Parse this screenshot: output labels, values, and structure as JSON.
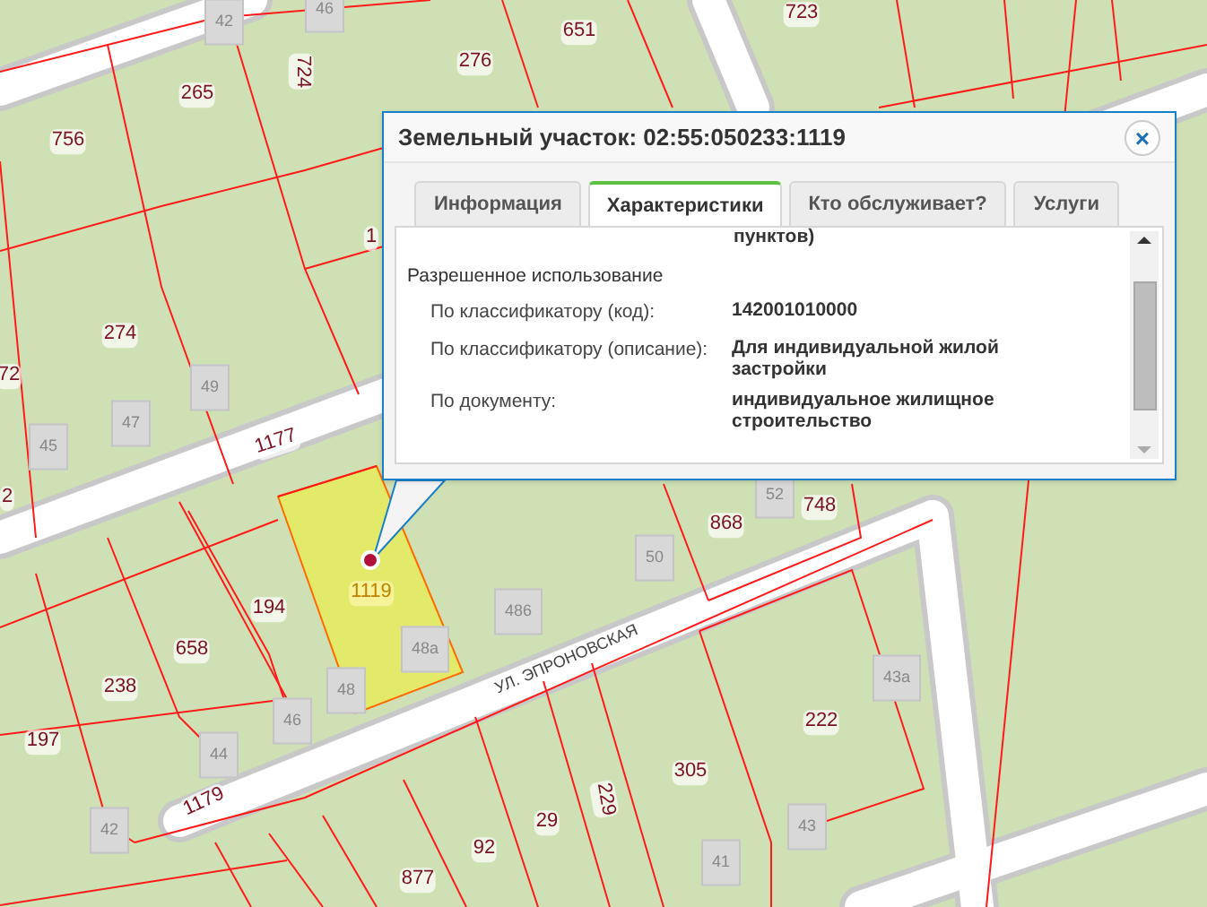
{
  "map": {
    "labels": [
      {
        "kind": "building",
        "text": "42"
      },
      {
        "kind": "building",
        "text": "46"
      },
      {
        "kind": "parcel",
        "text": "651"
      },
      {
        "kind": "parcel",
        "text": "723"
      },
      {
        "kind": "parcel",
        "text": "265"
      },
      {
        "kind": "parcel",
        "text": "724"
      },
      {
        "kind": "parcel",
        "text": "276"
      },
      {
        "kind": "parcel",
        "text": "756"
      },
      {
        "kind": "parcel",
        "text": "274"
      },
      {
        "kind": "parcel",
        "text": "72"
      },
      {
        "kind": "parcel",
        "text": "1"
      },
      {
        "kind": "parcel",
        "text": "1177"
      },
      {
        "kind": "building",
        "text": "49"
      },
      {
        "kind": "building",
        "text": "47"
      },
      {
        "kind": "building",
        "text": "45"
      },
      {
        "kind": "parcel",
        "text": "2"
      },
      {
        "kind": "parcel",
        "text": "868"
      },
      {
        "kind": "building",
        "text": "52"
      },
      {
        "kind": "parcel",
        "text": "748"
      },
      {
        "kind": "building",
        "text": "50"
      },
      {
        "kind": "building",
        "text": "486"
      },
      {
        "kind": "selected",
        "text": "1119"
      },
      {
        "kind": "building",
        "text": "48а"
      },
      {
        "kind": "parcel",
        "text": "194"
      },
      {
        "kind": "parcel",
        "text": "658"
      },
      {
        "kind": "parcel",
        "text": "238"
      },
      {
        "kind": "parcel",
        "text": "197"
      },
      {
        "kind": "building",
        "text": "48"
      },
      {
        "kind": "building",
        "text": "46"
      },
      {
        "kind": "building",
        "text": "44"
      },
      {
        "kind": "parcel",
        "text": "1179"
      },
      {
        "kind": "building",
        "text": "42"
      },
      {
        "kind": "building",
        "text": "43а"
      },
      {
        "kind": "parcel",
        "text": "222"
      },
      {
        "kind": "parcel",
        "text": "305"
      },
      {
        "kind": "parcel",
        "text": "229"
      },
      {
        "kind": "parcel",
        "text": "92"
      },
      {
        "kind": "parcel",
        "text": "29"
      },
      {
        "kind": "parcel",
        "text": "877"
      },
      {
        "kind": "building",
        "text": "43"
      },
      {
        "kind": "building",
        "text": "41"
      },
      {
        "kind": "street",
        "text": "УЛ. ЭПРОНОВСКАЯ"
      }
    ]
  },
  "popup": {
    "title": "Земельный участок: 02:55:050233:1119",
    "close": "×",
    "tabs": [
      {
        "label": "Информация",
        "selected": false
      },
      {
        "label": "Характеристики",
        "selected": true
      },
      {
        "label": "Кто обслуживает?",
        "selected": false
      },
      {
        "label": "Услуги",
        "selected": false
      }
    ],
    "cut_text": "пунктов)",
    "section": "Разрешенное использование",
    "rows": [
      {
        "label": "По классификатору (код):",
        "value": "142001010000"
      },
      {
        "label": "По классификатору (описание):",
        "value": "Для индивидуальной жилой застройки"
      },
      {
        "label": "По документу:",
        "value": "индивидуальное жилищное строительство"
      }
    ]
  }
}
